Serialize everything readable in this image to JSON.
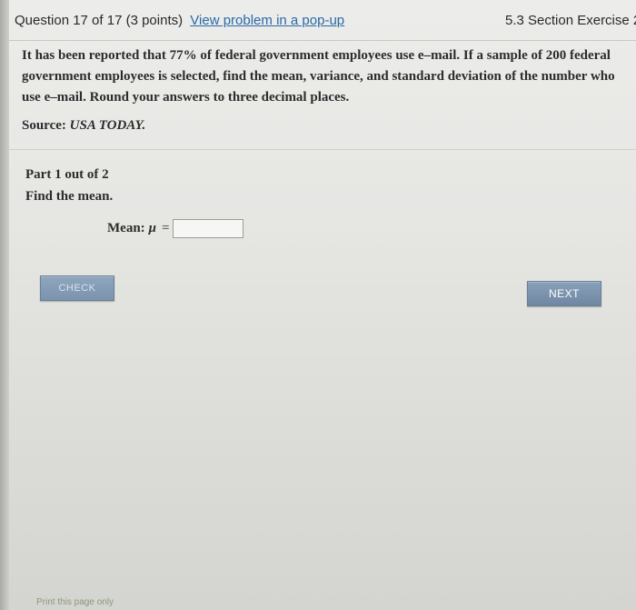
{
  "header": {
    "question_info": "Question 17 of 17 (3 points)",
    "popup_link": "View problem in a pop-up",
    "section": "5.3 Section Exercise 2"
  },
  "problem": {
    "text": "It has been reported that 77% of federal government employees use e–mail. If a sample of 200 federal government employees is selected, find the mean, variance, and standard deviation of the number who use e–mail. Round your answers to three decimal places.",
    "source_label": "Source:",
    "source_name": "USA TODAY."
  },
  "part": {
    "label": "Part 1 out of 2",
    "instruction": "Find the mean."
  },
  "answer": {
    "label": "Mean:",
    "symbol": "μ",
    "equals": "=",
    "value": ""
  },
  "buttons": {
    "check": "CHECK",
    "next": "NEXT"
  },
  "footer": {
    "print": "Print this page only"
  },
  "colors": {
    "link": "#2a6aa8",
    "button": "#7b93ad"
  }
}
